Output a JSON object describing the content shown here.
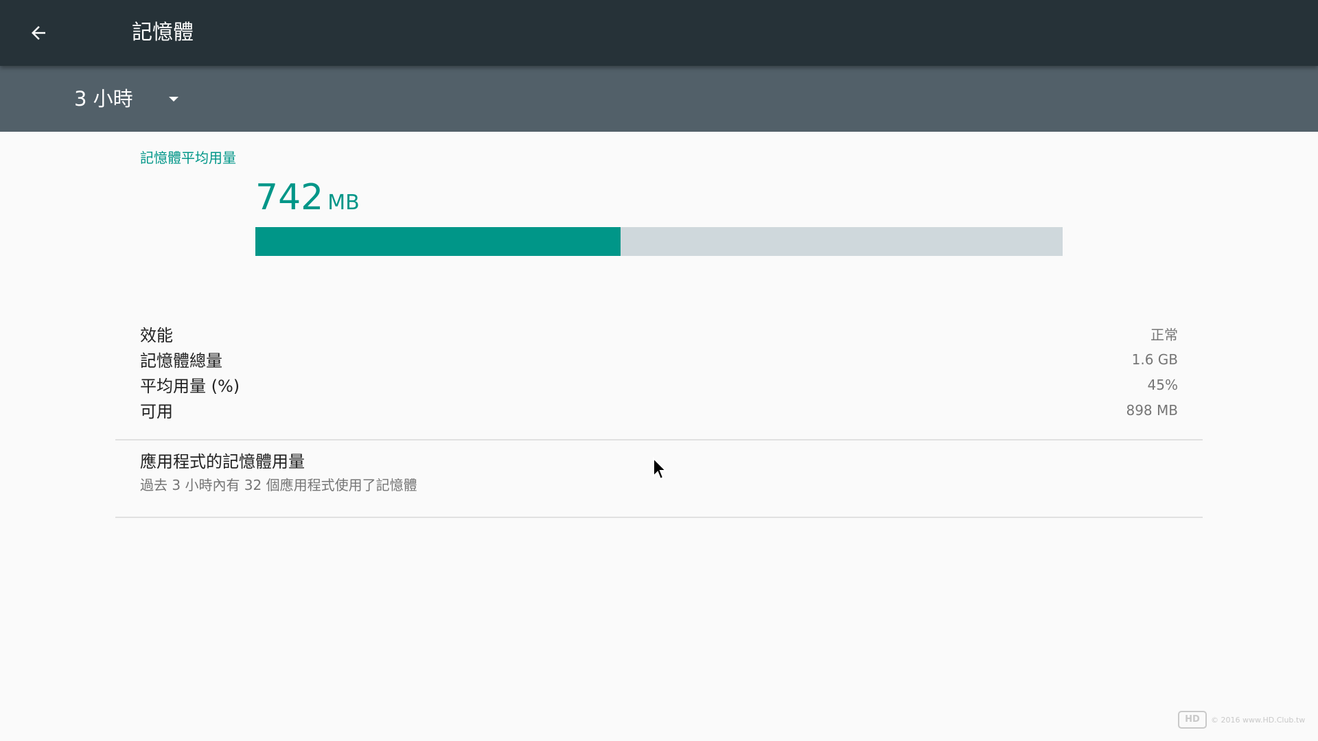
{
  "appbar": {
    "title": "記憶體",
    "back_icon": "arrow-left-icon"
  },
  "filter": {
    "period": "3 小時",
    "dropdown_icon": "dropdown-triangle-icon"
  },
  "summary": {
    "section_label": "記憶體平均用量",
    "value": "742",
    "unit": "MB",
    "usage_fraction": 0.452
  },
  "stats": [
    {
      "label": "效能",
      "value": "正常"
    },
    {
      "label": "記憶體總量",
      "value": "1.6 GB"
    },
    {
      "label": "平均用量 (%)",
      "value": "45%"
    },
    {
      "label": "可用",
      "value": "898 MB"
    }
  ],
  "apps_usage": {
    "title": "應用程式的記憶體用量",
    "summary": "過去 3 小時內有 32 個應用程式使用了記憶體"
  },
  "watermark": {
    "logo": "HD",
    "text": "© 2016 www.HD.Club.tw"
  },
  "colors": {
    "appbar": "#263238",
    "filterbar": "#526069",
    "accent": "#009688",
    "bar_track": "#cfd8dc"
  }
}
